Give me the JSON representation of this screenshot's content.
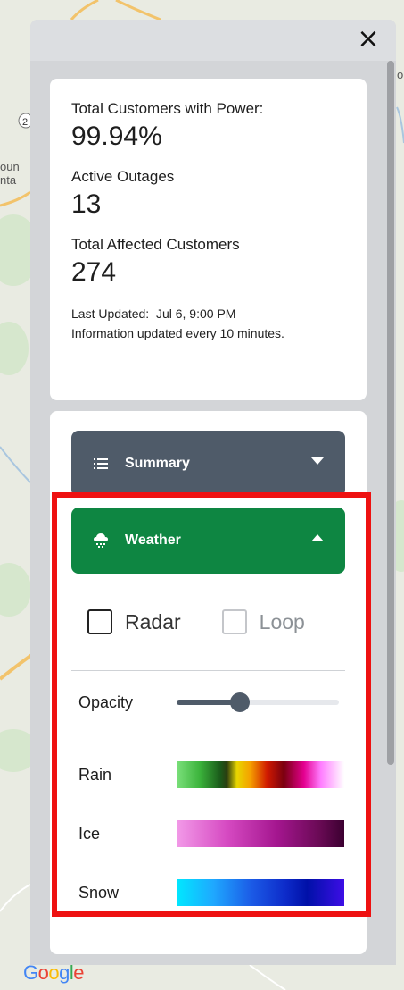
{
  "map": {
    "logo": "Google",
    "labels": [
      "2",
      "oun",
      "nta",
      "o"
    ]
  },
  "panel": {
    "close_icon": "×"
  },
  "stats": {
    "customers_power_label": "Total Customers with Power:",
    "customers_power_value": "99.94%",
    "active_outages_label": "Active Outages",
    "active_outages_value": "13",
    "affected_label": "Total Affected Customers",
    "affected_value": "274",
    "last_updated": "Last Updated:  Jul 6, 9:00 PM",
    "update_frequency": "Information updated every 10 minutes."
  },
  "accordion": {
    "summary_label": "Summary",
    "weather_label": "Weather"
  },
  "weather": {
    "radar_label": "Radar",
    "radar_checked": false,
    "loop_label": "Loop",
    "loop_enabled": false,
    "opacity_label": "Opacity",
    "opacity_value": 0.39,
    "legend": [
      {
        "label": "Rain"
      },
      {
        "label": "Ice"
      },
      {
        "label": "Snow"
      }
    ]
  },
  "colors": {
    "summary_bg": "#4f5b69",
    "weather_bg": "#0e8642",
    "highlight": "#ee1111"
  }
}
